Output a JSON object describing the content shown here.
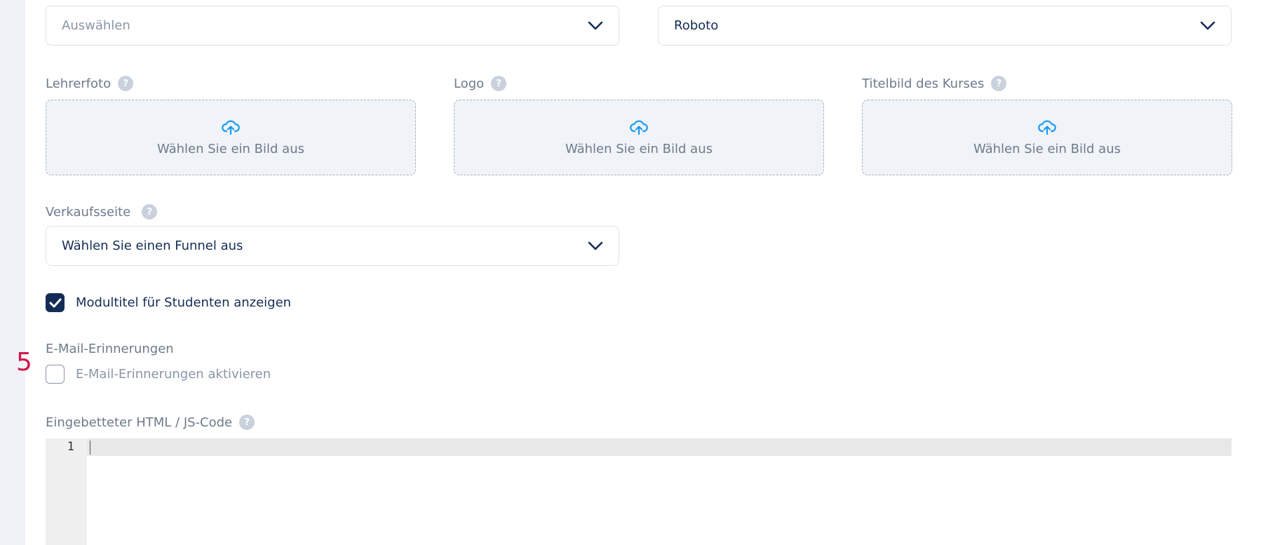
{
  "form": {
    "select_top_left": {
      "value": "Auswählen",
      "is_placeholder": true
    },
    "select_font": {
      "value": "Roboto"
    },
    "teacher_photo": {
      "label": "Lehrerfoto",
      "upload_text": "Wählen Sie ein Bild aus"
    },
    "logo": {
      "label": "Logo",
      "upload_text": "Wählen Sie ein Bild aus"
    },
    "course_cover": {
      "label": "Titelbild des Kurses",
      "upload_text": "Wählen Sie ein Bild aus"
    },
    "sales_page": {
      "label": "Verkaufsseite",
      "value": "Wählen Sie einen Funnel aus"
    },
    "module_title_checkbox": {
      "label": "Modultitel für Studenten anzeigen",
      "checked": true
    },
    "email_reminders": {
      "heading": "E-Mail-Erinnerungen",
      "checkbox_label": "E-Mail-Erinnerungen aktivieren",
      "checked": false,
      "annotation_marker": "5"
    },
    "embed_code": {
      "label": "Eingebetteter HTML / JS-Code",
      "line_numbers": [
        "1"
      ],
      "content": ""
    }
  },
  "icons": {
    "help": "question-icon",
    "chevron": "chevron-down-icon",
    "upload": "cloud-upload-icon",
    "check": "check-icon"
  },
  "colors": {
    "background": "#eff2f7",
    "panel": "#ffffff",
    "text_primary": "#142c55",
    "text_muted": "#6e7a8d",
    "placeholder": "#8a95a8",
    "accent_upload": "#1a9bf0",
    "checkbox_checked": "#142c55",
    "marker": "#d1164a"
  }
}
